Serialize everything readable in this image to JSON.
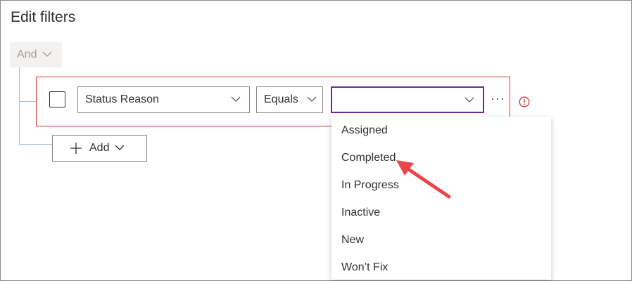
{
  "panel": {
    "title": "Edit filters"
  },
  "group": {
    "operator_label": "And"
  },
  "condition": {
    "attribute_value": "Status Reason",
    "operator_value": "Equals",
    "value_field_value": "",
    "more_label": "···"
  },
  "add_button": {
    "label": "Add"
  },
  "dropdown": {
    "options": [
      "Assigned",
      "Completed",
      "In Progress",
      "Inactive",
      "New",
      "Won’t Fix"
    ]
  },
  "colors": {
    "error": "#d13438",
    "focus": "#6b2d8f",
    "annotation_arrow": "#e8464a"
  },
  "icons": [
    "chevron-down-icon",
    "plus-icon",
    "error-icon",
    "more-icon"
  ]
}
